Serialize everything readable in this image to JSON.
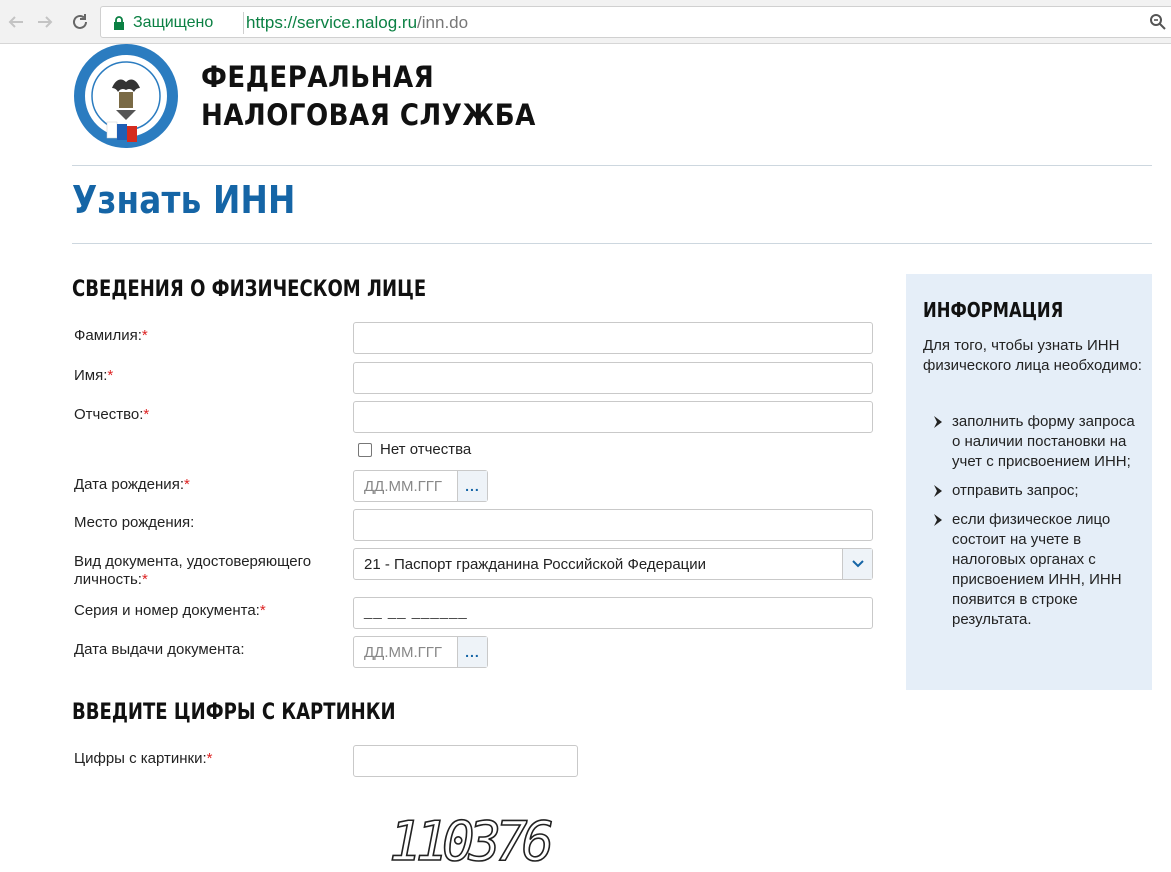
{
  "browser": {
    "secure_label": "Защищено",
    "url_host": "https://service.nalog.ru",
    "url_path": "/inn.do"
  },
  "header": {
    "agency_line1": "ФЕДЕРАЛЬНАЯ",
    "agency_line2": "НАЛОГОВАЯ СЛУЖБА",
    "emblem_text": "ФЕДЕРАЛЬНАЯ НАЛОГОВАЯ СЛУЖБА"
  },
  "page_title": "Узнать ИНН",
  "form": {
    "section_title": "СВЕДЕНИЯ О ФИЗИЧЕСКОМ ЛИЦЕ",
    "required_mark": "*",
    "surname_label": "Фамилия:",
    "name_label": "Имя:",
    "patronymic_label": "Отчество:",
    "no_patronymic_label": "Нет отчества",
    "birth_date_label": "Дата рождения:",
    "date_placeholder": "ДД.ММ.ГГГ",
    "birth_place_label": "Место рождения:",
    "doc_type_label_line1": "Вид документа, удостоверяющего",
    "doc_type_label_line2": "личность:",
    "doc_type_value": "21 - Паспорт гражданина Российской Федерации",
    "doc_number_label": "Серия и номер документа:",
    "doc_number_mask": "__ __ ______",
    "doc_date_label": "Дата выдачи документа:",
    "calendar_button": "..."
  },
  "captcha": {
    "section_title": "ВВЕДИТЕ ЦИФРЫ С КАРТИНКИ",
    "label": "Цифры с картинки:",
    "image_text": "110376"
  },
  "info": {
    "title": "ИНФОРМАЦИЯ",
    "intro": "Для того, чтобы узнать ИНН физического лица необходимо:",
    "items": [
      "заполнить форму запроса о наличии постановки на учет с присвоением ИНН;",
      "отправить запрос;",
      "если физическое лицо состоит на учете в налоговых органах с присвоением ИНН, ИНН появится в строке результата."
    ]
  },
  "colors": {
    "brand_blue": "#1565a6",
    "required_red": "#dd2222",
    "panel_bg": "#e5eef8",
    "secure_green": "#0b8043"
  }
}
